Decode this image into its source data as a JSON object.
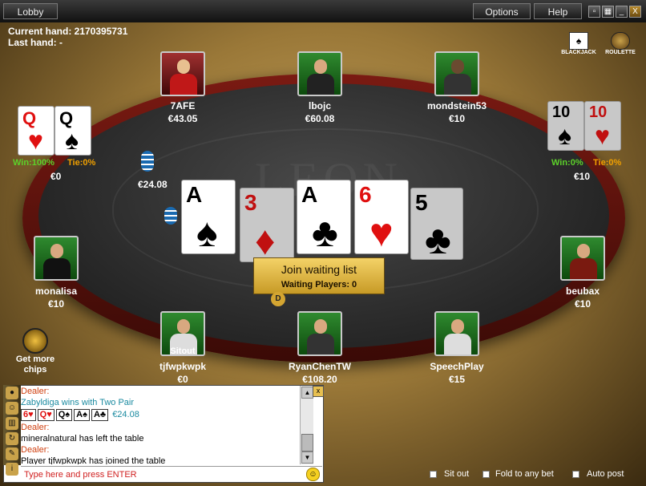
{
  "titlebar": {
    "lobby": "Lobby",
    "options": "Options",
    "help": "Help",
    "minimize": "_",
    "maximize": "□",
    "close": "X"
  },
  "info": {
    "current_hand": "Current hand: 2170395731",
    "last_hand": "Last hand: -"
  },
  "games": {
    "blackjack": "BLACKJACK",
    "roulette": "ROULETTE"
  },
  "watermark": "LEON",
  "players": [
    {
      "name": "7AFE",
      "stack": "€43.05"
    },
    {
      "name": "lbojc",
      "stack": "€60.08"
    },
    {
      "name": "mondstein53",
      "stack": "€10"
    },
    {
      "name": "monaIisa",
      "stack": "€10"
    },
    {
      "name": "beubax",
      "stack": "€10"
    },
    {
      "name": "tjfwpkwpk",
      "stack": "€0",
      "status": "Sitout"
    },
    {
      "name": "RyanChenTW",
      "stack": "€108.20"
    },
    {
      "name": "SpeechPlay",
      "stack": "€15"
    }
  ],
  "left_side": {
    "card1": "Q",
    "card2": "Q",
    "win": "Win:100%",
    "tie": "Tie:0%",
    "amount": "€0"
  },
  "right_side": {
    "card1": "10",
    "card2": "10",
    "win": "Win:0%",
    "tie": "Tie:0%",
    "amount": "€10"
  },
  "pot": {
    "bet": "€24.08"
  },
  "board": [
    {
      "rank": "A",
      "suit": "♠",
      "color": "#000000"
    },
    {
      "rank": "3",
      "suit": "♦",
      "color": "#e01010"
    },
    {
      "rank": "A",
      "suit": "♣",
      "color": "#000000"
    },
    {
      "rank": "6",
      "suit": "♥",
      "color": "#e01010"
    },
    {
      "rank": "5",
      "suit": "♣",
      "color": "#000000"
    }
  ],
  "join": {
    "label": "Join waiting list",
    "waiting": "Waiting Players: 0"
  },
  "dealer_button": "D",
  "get_more_chips": "Get more chips",
  "chat": {
    "lines": [
      {
        "type": "dealer",
        "text": "Dealer:"
      },
      {
        "type": "teal",
        "text": "Zabyldiga wins with Two Pair"
      },
      {
        "type": "cards",
        "cards": [
          "6♥",
          "Q♥",
          "Q♠",
          "A♠",
          "A♣"
        ],
        "amount": "€24.08"
      },
      {
        "type": "dealer",
        "text": "Dealer:"
      },
      {
        "type": "msg",
        "text": "mineralnatural has left the table"
      },
      {
        "type": "dealer",
        "text": "Dealer:"
      },
      {
        "type": "msg",
        "text": "Player tjfwpkwpk has joined the table"
      }
    ],
    "input_placeholder": "Type here and press ENTER"
  },
  "bottom": {
    "sit_out": "Sit out",
    "fold_any": "Fold to any bet",
    "auto_post": "Auto post"
  }
}
